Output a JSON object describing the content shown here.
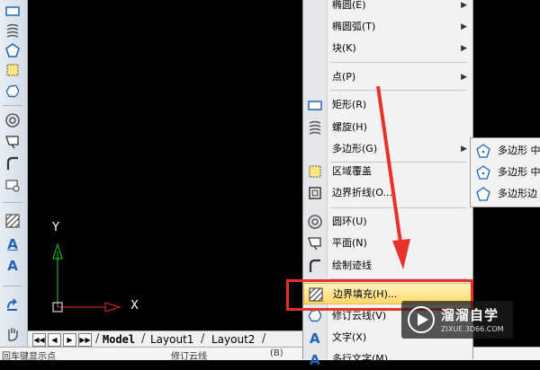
{
  "left_toolbar": {
    "icons": [
      "rectangle-icon",
      "helix-icon",
      "polygon-icon",
      "revision-cloud-icon",
      "donut-icon",
      "planar-surface-icon",
      "sketch-icon",
      "wipeout-icon",
      "hatch-icon",
      "mtext-icon",
      "text-icon",
      "redo-icon",
      "pan-hand-icon"
    ],
    "mtext_glyph": "A",
    "text_glyph": "A"
  },
  "canvas": {
    "x_axis_label": "X",
    "y_axis_label": "Y",
    "background": "#000000"
  },
  "layout_tabs": {
    "nav_buttons": [
      "◀◀",
      "◀",
      "▶",
      "▶▶"
    ],
    "tabs": [
      {
        "label": "Model",
        "active": true
      },
      {
        "label": "Layout1",
        "active": false
      },
      {
        "label": "Layout2",
        "active": false
      }
    ],
    "divider": "/"
  },
  "bottom_fragments": [
    "回车键显示点",
    "修订云线",
    "(B)"
  ],
  "draw_menu": {
    "items": [
      {
        "label": "椭圆(E)",
        "submenu": true
      },
      {
        "label": "椭圆弧(T)",
        "submenu": true
      },
      {
        "label": "块(K)",
        "submenu": true
      },
      {
        "label": "点(P)",
        "submenu": true
      },
      {
        "label": "矩形(R)",
        "submenu": false,
        "icon": "rectangle-icon"
      },
      {
        "label": "螺旋(H)",
        "submenu": false,
        "icon": "helix-icon"
      },
      {
        "label": "多边形(G)",
        "submenu": true
      },
      {
        "label": "区域覆盖",
        "submenu": false,
        "icon": "wipeout-icon"
      },
      {
        "label": "边界折线(O...",
        "submenu": false,
        "icon": "boundary-polyline-icon"
      },
      {
        "label": "圆环(U)",
        "submenu": false,
        "icon": "donut-icon"
      },
      {
        "label": "平面(N)",
        "submenu": false,
        "icon": "planar-surface-icon"
      },
      {
        "label": "绘制迹线",
        "submenu": false,
        "icon": "sketch-icon"
      },
      {
        "label": "边界填充(H)...",
        "submenu": false,
        "icon": "hatch-icon",
        "highlighted": true
      },
      {
        "label": "修订云线(V)",
        "submenu": false,
        "icon": "revision-cloud-icon"
      },
      {
        "label": "文字(X)",
        "submenu": false,
        "icon": "text-icon"
      },
      {
        "label": "多行文字(M)",
        "submenu": false,
        "icon": "mtext-icon"
      }
    ],
    "submenu_arrow": "▶"
  },
  "polygon_submenu": {
    "items": [
      {
        "label": "多边形 中心"
      },
      {
        "label": "多边形 中心"
      },
      {
        "label": "多边形边"
      }
    ]
  },
  "watermark": {
    "title": "溜溜自学",
    "url": "ZIXUE.3D66.COM"
  },
  "colors": {
    "highlight_border": "#e8312a",
    "arrow_red": "#e8312a",
    "axis_green": "#22cc22",
    "axis_red": "#e03030",
    "icon_blue": "#1e63b6"
  }
}
